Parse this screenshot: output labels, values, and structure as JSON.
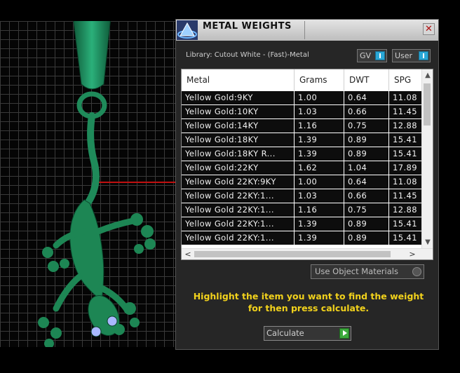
{
  "dialog": {
    "title": "METAL WEIGHTS",
    "close_glyph": "✕",
    "library_label": "Library: Cutout White - (Fast)-Metal",
    "gv_toggle": "GV",
    "user_toggle": "User"
  },
  "table": {
    "columns": [
      "Metal",
      "Grams",
      "DWT",
      "SPG"
    ],
    "rows": [
      [
        "Yellow Gold:9KY",
        "1.00",
        "0.64",
        "11.08"
      ],
      [
        "Yellow Gold:10KY",
        "1.03",
        "0.66",
        "11.45"
      ],
      [
        "Yellow Gold:14KY",
        "1.16",
        "0.75",
        "12.88"
      ],
      [
        "Yellow Gold:18KY",
        "1.39",
        "0.89",
        "15.41"
      ],
      [
        "Yellow Gold:18KY R...",
        "1.39",
        "0.89",
        "15.41"
      ],
      [
        "Yellow Gold:22KY",
        "1.62",
        "1.04",
        "17.89"
      ],
      [
        "Yellow Gold 22KY:9KY",
        "1.00",
        "0.64",
        "11.08"
      ],
      [
        "Yellow Gold 22KY:1...",
        "1.03",
        "0.66",
        "11.45"
      ],
      [
        "Yellow Gold 22KY:1...",
        "1.16",
        "0.75",
        "12.88"
      ],
      [
        "Yellow Gold 22KY:1...",
        "1.39",
        "0.89",
        "15.41"
      ],
      [
        "Yellow Gold 22KY:1...",
        "1.39",
        "0.89",
        "15.41"
      ]
    ],
    "scroll_up": "▲",
    "scroll_down": "▼",
    "scroll_left": "<",
    "scroll_right": ">"
  },
  "use_object_materials": "Use Object Materials",
  "instructions": "Highlight the item you want to find the weight for then press calculate.",
  "calculate_button": "Calculate",
  "colors": {
    "accent_yellow": "#f2d21c",
    "model_green": "#1f8a5a",
    "toggle_blue": "#2aa7d6",
    "calc_green": "#3ca83c"
  }
}
